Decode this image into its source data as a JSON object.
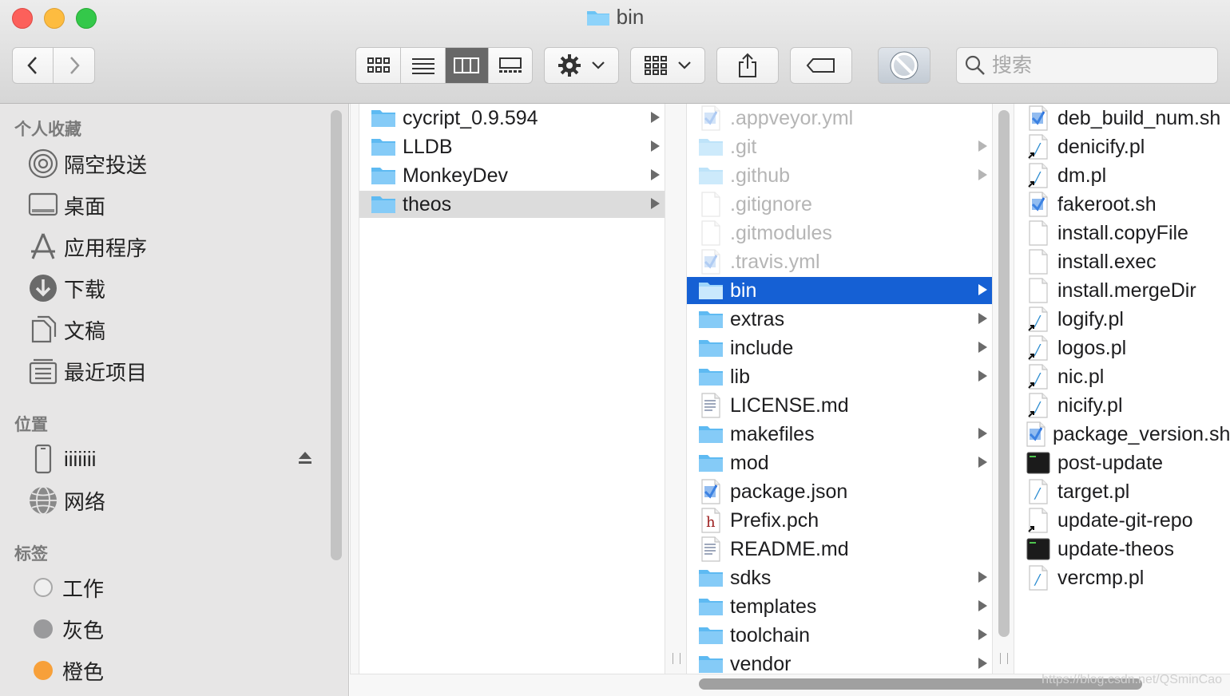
{
  "window": {
    "title": "bin"
  },
  "toolbar": {
    "search_placeholder": "搜索",
    "icons": [
      "chevron-left-icon",
      "chevron-right-icon",
      "icon-view-icon",
      "list-view-icon",
      "column-view-icon",
      "gallery-view-icon",
      "gear-icon",
      "group-icon",
      "share-icon",
      "tag-icon",
      "no-entry-icon",
      "search-icon"
    ]
  },
  "sidebar": {
    "favorites_header": "个人收藏",
    "favorites": [
      {
        "label": "隔空投送",
        "icon": "airdrop-icon"
      },
      {
        "label": "桌面",
        "icon": "desktop-icon"
      },
      {
        "label": "应用程序",
        "icon": "applications-icon"
      },
      {
        "label": "下载",
        "icon": "downloads-icon"
      },
      {
        "label": "文稿",
        "icon": "documents-icon"
      },
      {
        "label": "最近项目",
        "icon": "recents-icon"
      }
    ],
    "locations_header": "位置",
    "locations": [
      {
        "label": "iiiiiii",
        "icon": "iphone-icon"
      },
      {
        "label": "网络",
        "icon": "network-icon"
      }
    ],
    "tags_header": "标签",
    "tags": [
      {
        "label": "工作",
        "color": "#e6e6e6"
      },
      {
        "label": "灰色",
        "color": "#9a9a9c"
      },
      {
        "label": "橙色",
        "color": "#f7a03a"
      }
    ]
  },
  "columns": [
    [
      {
        "name": "cycript_0.9.594",
        "kind": "folder",
        "arrow": true
      },
      {
        "name": "LLDB",
        "kind": "folder",
        "arrow": true
      },
      {
        "name": "MonkeyDev",
        "kind": "folder",
        "arrow": true
      },
      {
        "name": "theos",
        "kind": "folder",
        "arrow": true,
        "selected": "gray"
      }
    ],
    [
      {
        "name": ".appveyor.yml",
        "kind": "script",
        "dim": true
      },
      {
        "name": ".git",
        "kind": "folder",
        "arrow": true,
        "dim": true
      },
      {
        "name": ".github",
        "kind": "folder",
        "arrow": true,
        "dim": true
      },
      {
        "name": ".gitignore",
        "kind": "doc",
        "dim": true
      },
      {
        "name": ".gitmodules",
        "kind": "doc",
        "dim": true
      },
      {
        "name": ".travis.yml",
        "kind": "script",
        "dim": true
      },
      {
        "name": "bin",
        "kind": "folder",
        "arrow": true,
        "selected": "blue"
      },
      {
        "name": "extras",
        "kind": "folder",
        "arrow": true
      },
      {
        "name": "include",
        "kind": "folder",
        "arrow": true
      },
      {
        "name": "lib",
        "kind": "folder",
        "arrow": true
      },
      {
        "name": "LICENSE.md",
        "kind": "text"
      },
      {
        "name": "makefiles",
        "kind": "folder",
        "arrow": true
      },
      {
        "name": "mod",
        "kind": "folder",
        "arrow": true
      },
      {
        "name": "package.json",
        "kind": "script"
      },
      {
        "name": "Prefix.pch",
        "kind": "header"
      },
      {
        "name": "README.md",
        "kind": "text"
      },
      {
        "name": "sdks",
        "kind": "folder",
        "arrow": true
      },
      {
        "name": "templates",
        "kind": "folder",
        "arrow": true
      },
      {
        "name": "toolchain",
        "kind": "folder",
        "arrow": true
      },
      {
        "name": "vendor",
        "kind": "folder",
        "arrow": true
      }
    ],
    [
      {
        "name": "deb_build_num.sh",
        "kind": "script"
      },
      {
        "name": "denicify.pl",
        "kind": "perl-alias"
      },
      {
        "name": "dm.pl",
        "kind": "perl-alias"
      },
      {
        "name": "fakeroot.sh",
        "kind": "script"
      },
      {
        "name": "install.copyFile",
        "kind": "doc"
      },
      {
        "name": "install.exec",
        "kind": "doc"
      },
      {
        "name": "install.mergeDir",
        "kind": "doc"
      },
      {
        "name": "logify.pl",
        "kind": "perl-alias"
      },
      {
        "name": "logos.pl",
        "kind": "perl-alias"
      },
      {
        "name": "nic.pl",
        "kind": "perl-alias"
      },
      {
        "name": "nicify.pl",
        "kind": "perl-alias"
      },
      {
        "name": "package_version.sh",
        "kind": "script"
      },
      {
        "name": "post-update",
        "kind": "exec"
      },
      {
        "name": "target.pl",
        "kind": "perl"
      },
      {
        "name": "update-git-repo",
        "kind": "doc-alias"
      },
      {
        "name": "update-theos",
        "kind": "exec"
      },
      {
        "name": "vercmp.pl",
        "kind": "perl"
      }
    ]
  ],
  "watermark": "https://blog.csdn.net/QSminCao"
}
